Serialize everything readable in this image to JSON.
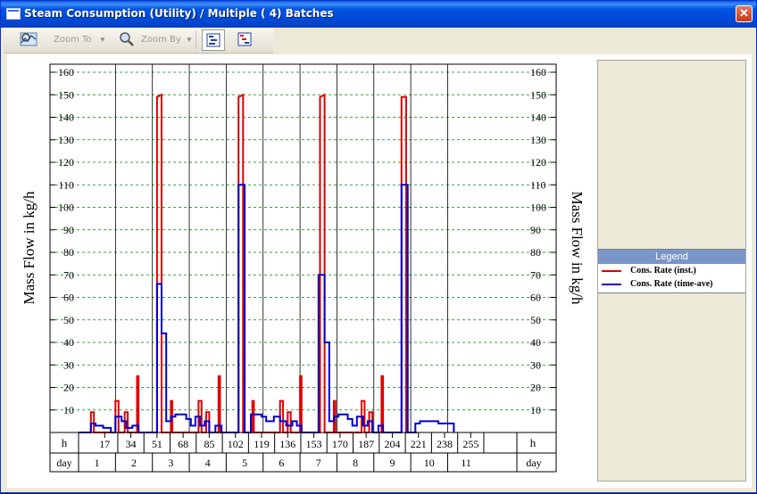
{
  "window": {
    "title": "Steam Consumption (Utility) / Multiple ( 4) Batches",
    "close_glyph": "✕"
  },
  "toolbar": {
    "zoom_to_label": "Zoom To",
    "zoom_by_label": "Zoom By",
    "icons": [
      "zoom-to-icon",
      "zoom-by-icon",
      "chart-view-icon",
      "gantt-view-icon"
    ]
  },
  "legend": {
    "title": "Legend",
    "items": [
      {
        "label": "Cons. Rate (inst.)",
        "color": "#e00000"
      },
      {
        "label": "Cons. Rate (time-ave)",
        "color": "#0000d0"
      }
    ]
  },
  "chart_data": {
    "type": "line",
    "ylabel_left": "Mass Flow in kg/h",
    "ylabel_right": "Mass Flow in kg/h",
    "ylim": [
      0,
      160
    ],
    "yticks": [
      10,
      20,
      30,
      40,
      50,
      60,
      70,
      80,
      90,
      100,
      110,
      120,
      130,
      140,
      150,
      160
    ],
    "grid": true,
    "xlim_h": [
      0,
      285
    ],
    "h_row_label": "h",
    "day_row_label": "day",
    "h_ticks": [
      17,
      34,
      51,
      68,
      85,
      102,
      119,
      136,
      153,
      170,
      187,
      204,
      221,
      238,
      255
    ],
    "day_labels": [
      "1",
      "2",
      "3",
      "4",
      "5",
      "6",
      "7",
      "8",
      "9",
      "10",
      "11"
    ],
    "series": [
      {
        "name": "Cons. Rate (inst.)",
        "color": "#e00000",
        "points": [
          [
            0,
            0
          ],
          [
            8,
            0
          ],
          [
            8,
            9
          ],
          [
            10,
            9
          ],
          [
            10,
            0
          ],
          [
            24,
            0
          ],
          [
            24,
            14
          ],
          [
            26,
            14
          ],
          [
            26,
            0
          ],
          [
            30,
            0
          ],
          [
            30,
            9
          ],
          [
            32,
            9
          ],
          [
            32,
            0
          ],
          [
            38,
            0
          ],
          [
            38,
            25
          ],
          [
            39,
            25
          ],
          [
            39,
            0
          ],
          [
            51,
            0
          ],
          [
            51,
            149
          ],
          [
            54,
            150
          ],
          [
            54,
            0
          ],
          [
            60,
            0
          ],
          [
            60,
            14
          ],
          [
            61,
            14
          ],
          [
            61,
            0
          ],
          [
            78,
            0
          ],
          [
            78,
            14
          ],
          [
            80,
            14
          ],
          [
            80,
            0
          ],
          [
            83,
            0
          ],
          [
            83,
            9
          ],
          [
            85,
            9
          ],
          [
            85,
            0
          ],
          [
            91,
            0
          ],
          [
            91,
            25
          ],
          [
            92,
            25
          ],
          [
            92,
            0
          ],
          [
            104,
            0
          ],
          [
            104,
            149
          ],
          [
            107,
            150
          ],
          [
            107,
            0
          ],
          [
            113,
            0
          ],
          [
            113,
            14
          ],
          [
            114,
            14
          ],
          [
            114,
            0
          ],
          [
            131,
            0
          ],
          [
            131,
            14
          ],
          [
            133,
            14
          ],
          [
            133,
            0
          ],
          [
            136,
            0
          ],
          [
            136,
            9
          ],
          [
            138,
            9
          ],
          [
            138,
            0
          ],
          [
            144,
            0
          ],
          [
            144,
            25
          ],
          [
            145,
            25
          ],
          [
            145,
            0
          ],
          [
            157,
            0
          ],
          [
            157,
            149
          ],
          [
            160,
            150
          ],
          [
            160,
            0
          ],
          [
            166,
            0
          ],
          [
            166,
            14
          ],
          [
            167,
            14
          ],
          [
            167,
            0
          ],
          [
            184,
            0
          ],
          [
            184,
            14
          ],
          [
            186,
            14
          ],
          [
            186,
            0
          ],
          [
            189,
            0
          ],
          [
            189,
            9
          ],
          [
            191,
            9
          ],
          [
            191,
            0
          ],
          [
            197,
            0
          ],
          [
            197,
            25
          ],
          [
            198,
            25
          ],
          [
            198,
            0
          ],
          [
            210,
            0
          ],
          [
            210,
            149
          ],
          [
            213,
            149
          ],
          [
            213,
            0
          ],
          [
            220,
            0
          ]
        ]
      },
      {
        "name": "Cons. Rate (time-ave)",
        "color": "#0000d0",
        "points": [
          [
            0,
            0
          ],
          [
            8,
            0
          ],
          [
            8,
            4
          ],
          [
            11,
            4
          ],
          [
            11,
            3
          ],
          [
            16,
            3
          ],
          [
            16,
            2
          ],
          [
            21,
            2
          ],
          [
            21,
            0
          ],
          [
            24,
            0
          ],
          [
            24,
            7
          ],
          [
            28,
            7
          ],
          [
            28,
            5
          ],
          [
            31,
            5
          ],
          [
            31,
            2
          ],
          [
            35,
            2
          ],
          [
            35,
            3
          ],
          [
            39,
            3
          ],
          [
            39,
            0
          ],
          [
            51,
            0
          ],
          [
            51,
            66
          ],
          [
            54,
            66
          ],
          [
            54,
            44
          ],
          [
            57,
            44
          ],
          [
            57,
            5
          ],
          [
            60,
            5
          ],
          [
            60,
            7
          ],
          [
            63,
            7
          ],
          [
            63,
            8
          ],
          [
            70,
            8
          ],
          [
            70,
            6
          ],
          [
            73,
            6
          ],
          [
            73,
            3
          ],
          [
            76,
            3
          ],
          [
            76,
            7
          ],
          [
            79,
            7
          ],
          [
            79,
            3
          ],
          [
            82,
            3
          ],
          [
            82,
            5
          ],
          [
            85,
            5
          ],
          [
            85,
            0
          ],
          [
            89,
            0
          ],
          [
            89,
            3
          ],
          [
            93,
            3
          ],
          [
            93,
            0
          ],
          [
            104,
            0
          ],
          [
            104,
            110
          ],
          [
            108,
            110
          ],
          [
            108,
            0
          ],
          [
            112,
            0
          ],
          [
            112,
            8
          ],
          [
            119,
            8
          ],
          [
            119,
            7
          ],
          [
            122,
            7
          ],
          [
            122,
            5
          ],
          [
            127,
            5
          ],
          [
            127,
            7
          ],
          [
            131,
            7
          ],
          [
            131,
            5
          ],
          [
            135,
            5
          ],
          [
            135,
            3
          ],
          [
            139,
            3
          ],
          [
            139,
            5
          ],
          [
            142,
            5
          ],
          [
            142,
            3
          ],
          [
            145,
            3
          ],
          [
            145,
            0
          ],
          [
            156,
            0
          ],
          [
            156,
            70
          ],
          [
            160,
            70
          ],
          [
            160,
            40
          ],
          [
            163,
            40
          ],
          [
            163,
            5
          ],
          [
            166,
            5
          ],
          [
            166,
            7
          ],
          [
            169,
            7
          ],
          [
            169,
            8
          ],
          [
            175,
            8
          ],
          [
            175,
            6
          ],
          [
            178,
            6
          ],
          [
            178,
            3
          ],
          [
            181,
            3
          ],
          [
            181,
            7
          ],
          [
            185,
            7
          ],
          [
            185,
            3
          ],
          [
            188,
            3
          ],
          [
            188,
            5
          ],
          [
            191,
            5
          ],
          [
            191,
            0
          ],
          [
            195,
            0
          ],
          [
            195,
            3
          ],
          [
            198,
            3
          ],
          [
            198,
            0
          ],
          [
            210,
            0
          ],
          [
            210,
            110
          ],
          [
            214,
            110
          ],
          [
            214,
            0
          ],
          [
            219,
            0
          ],
          [
            219,
            4
          ],
          [
            222,
            4
          ],
          [
            222,
            5
          ],
          [
            234,
            5
          ],
          [
            234,
            4
          ],
          [
            244,
            4
          ],
          [
            244,
            0
          ]
        ]
      }
    ]
  }
}
